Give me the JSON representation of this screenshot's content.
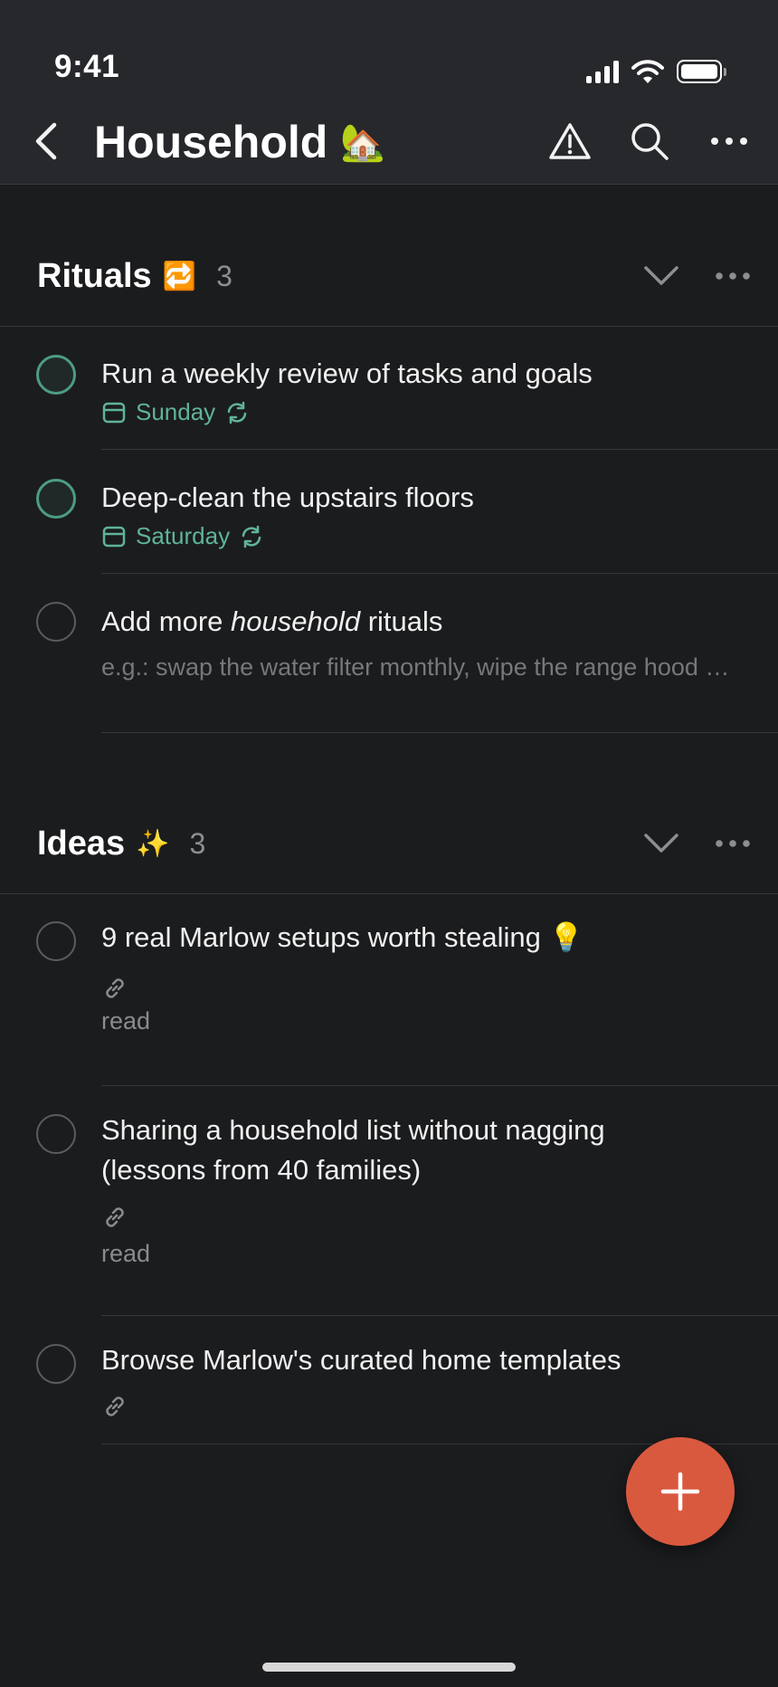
{
  "status_bar": {
    "time": "9:41"
  },
  "nav": {
    "title": "Household",
    "title_emoji": "🏡"
  },
  "sections": [
    {
      "title": "Rituals",
      "emoji": "🔁",
      "count": "3",
      "tasks": [
        {
          "title": "Run a weekly review of tasks and goals",
          "due": "Sunday",
          "recurring": true,
          "checkbox_color": "#4d9c86"
        },
        {
          "title": "Deep-clean the upstairs floors",
          "due": "Saturday",
          "recurring": true,
          "checkbox_color": "#4d9c86"
        },
        {
          "title_before": "Add more ",
          "title_italic": "household",
          "title_after": " rituals",
          "description": "e.g.: swap the water filter monthly, wipe the range hood weekly"
        }
      ]
    },
    {
      "title": "Ideas",
      "emoji": "✨",
      "count": "3",
      "tasks": [
        {
          "title": "9 real Marlow setups worth stealing 💡",
          "link": true,
          "label": "read"
        },
        {
          "title_line1": "Sharing a household list without nagging",
          "title_line2": "(lessons from 40 families)",
          "link": true,
          "label": "read"
        },
        {
          "title": "Browse Marlow's curated home templates",
          "link": true
        }
      ]
    }
  ],
  "colors": {
    "accent_teal": "#5fb39b",
    "fab": "#d9593f",
    "background": "#1b1c1e",
    "topbar": "#27282b"
  },
  "icons": [
    "chevron-left-icon",
    "warning-icon",
    "search-icon",
    "more-icon",
    "chevron-down-icon",
    "calendar-icon",
    "repeat-icon",
    "link-icon",
    "plus-icon"
  ]
}
